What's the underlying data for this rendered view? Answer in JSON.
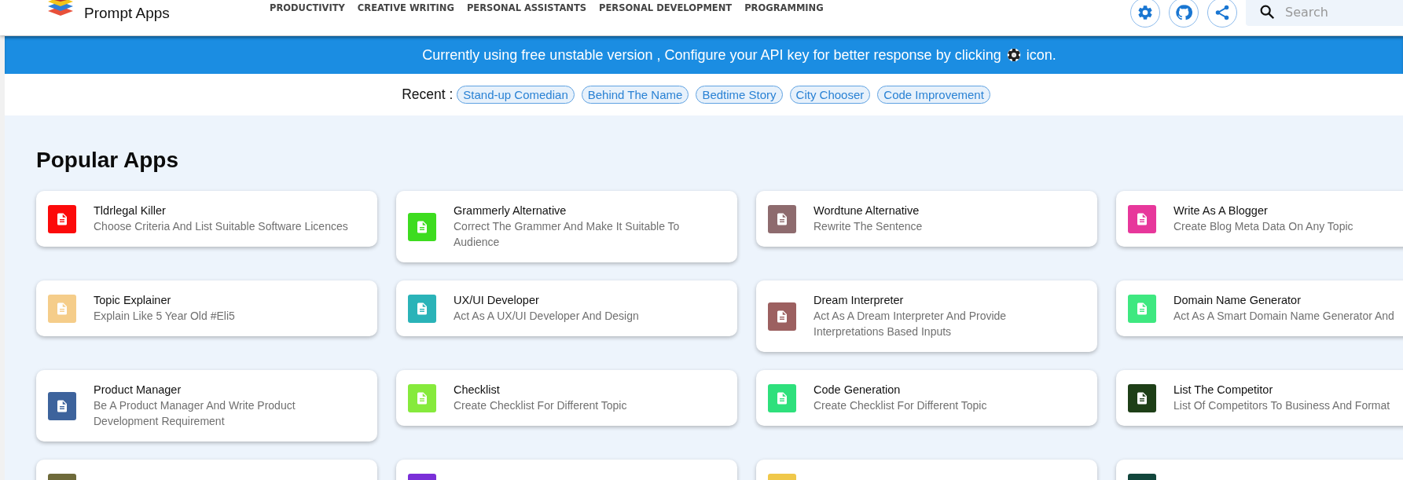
{
  "header": {
    "brand": "Prompt Apps",
    "nav": [
      "PRODUCTIVITY",
      "CREATIVE WRITING",
      "PERSONAL ASSISTANTS",
      "PERSONAL DEVELOPMENT",
      "PROGRAMMING"
    ],
    "search": {
      "placeholder": "Search"
    }
  },
  "banner": {
    "text_before": "Currently using free unstable version , Configure your API key for better response by clicking",
    "text_after": "icon."
  },
  "recent": {
    "label": "Recent :",
    "items": [
      "Stand-up Comedian",
      "Behind The Name",
      "Bedtime Story",
      "City Chooser",
      "Code Improvement"
    ]
  },
  "section_title": "Popular Apps",
  "apps": [
    {
      "title": "Tldrlegal Killer",
      "description": "Choose Criteria And List Suitable Software Licences",
      "color": "#fc0a0a"
    },
    {
      "title": "Grammerly Alternative",
      "description": "Correct The Grammer And Make It Suitable To Audience",
      "color": "#3ddc1f"
    },
    {
      "title": "Wordtune Alternative",
      "description": "Rewrite The Sentence",
      "color": "#8e6b6e"
    },
    {
      "title": "Write As A Blogger",
      "description": "Create Blog Meta Data On Any Topic",
      "color": "#e7379b"
    },
    {
      "title": "Topic Explainer",
      "description": "Explain Like 5 Year Old #Eli5",
      "color": "#f5cd8a"
    },
    {
      "title": "UX/UI Developer",
      "description": "Act As A UX/UI Developer And Design",
      "color": "#2ab3b8"
    },
    {
      "title": "Dream Interpreter",
      "description": "Act As A Dream Interpreter And Provide Interpretations Based Inputs",
      "color": "#9c6060"
    },
    {
      "title": "Domain Name Generator",
      "description": "Act As A Smart Domain Name Generator And",
      "color": "#3ee880"
    },
    {
      "title": "Product Manager",
      "description": "Be A Product Manager And Write Product Development Requirement",
      "color": "#3d639c"
    },
    {
      "title": "Checklist",
      "description": "Create Checklist For Different Topic",
      "color": "#86ea3c"
    },
    {
      "title": "Code Generation",
      "description": "Create Checklist For Different Topic",
      "color": "#2ee07c"
    },
    {
      "title": "List The Competitor",
      "description": "List Of Competitors To Business And Format",
      "color": "#1e3f17"
    },
    {
      "color": "#6e6a3a"
    },
    {
      "color": "#7a2fd8"
    },
    {
      "color": "#f0c84a"
    },
    {
      "color": "#12463c"
    }
  ]
}
